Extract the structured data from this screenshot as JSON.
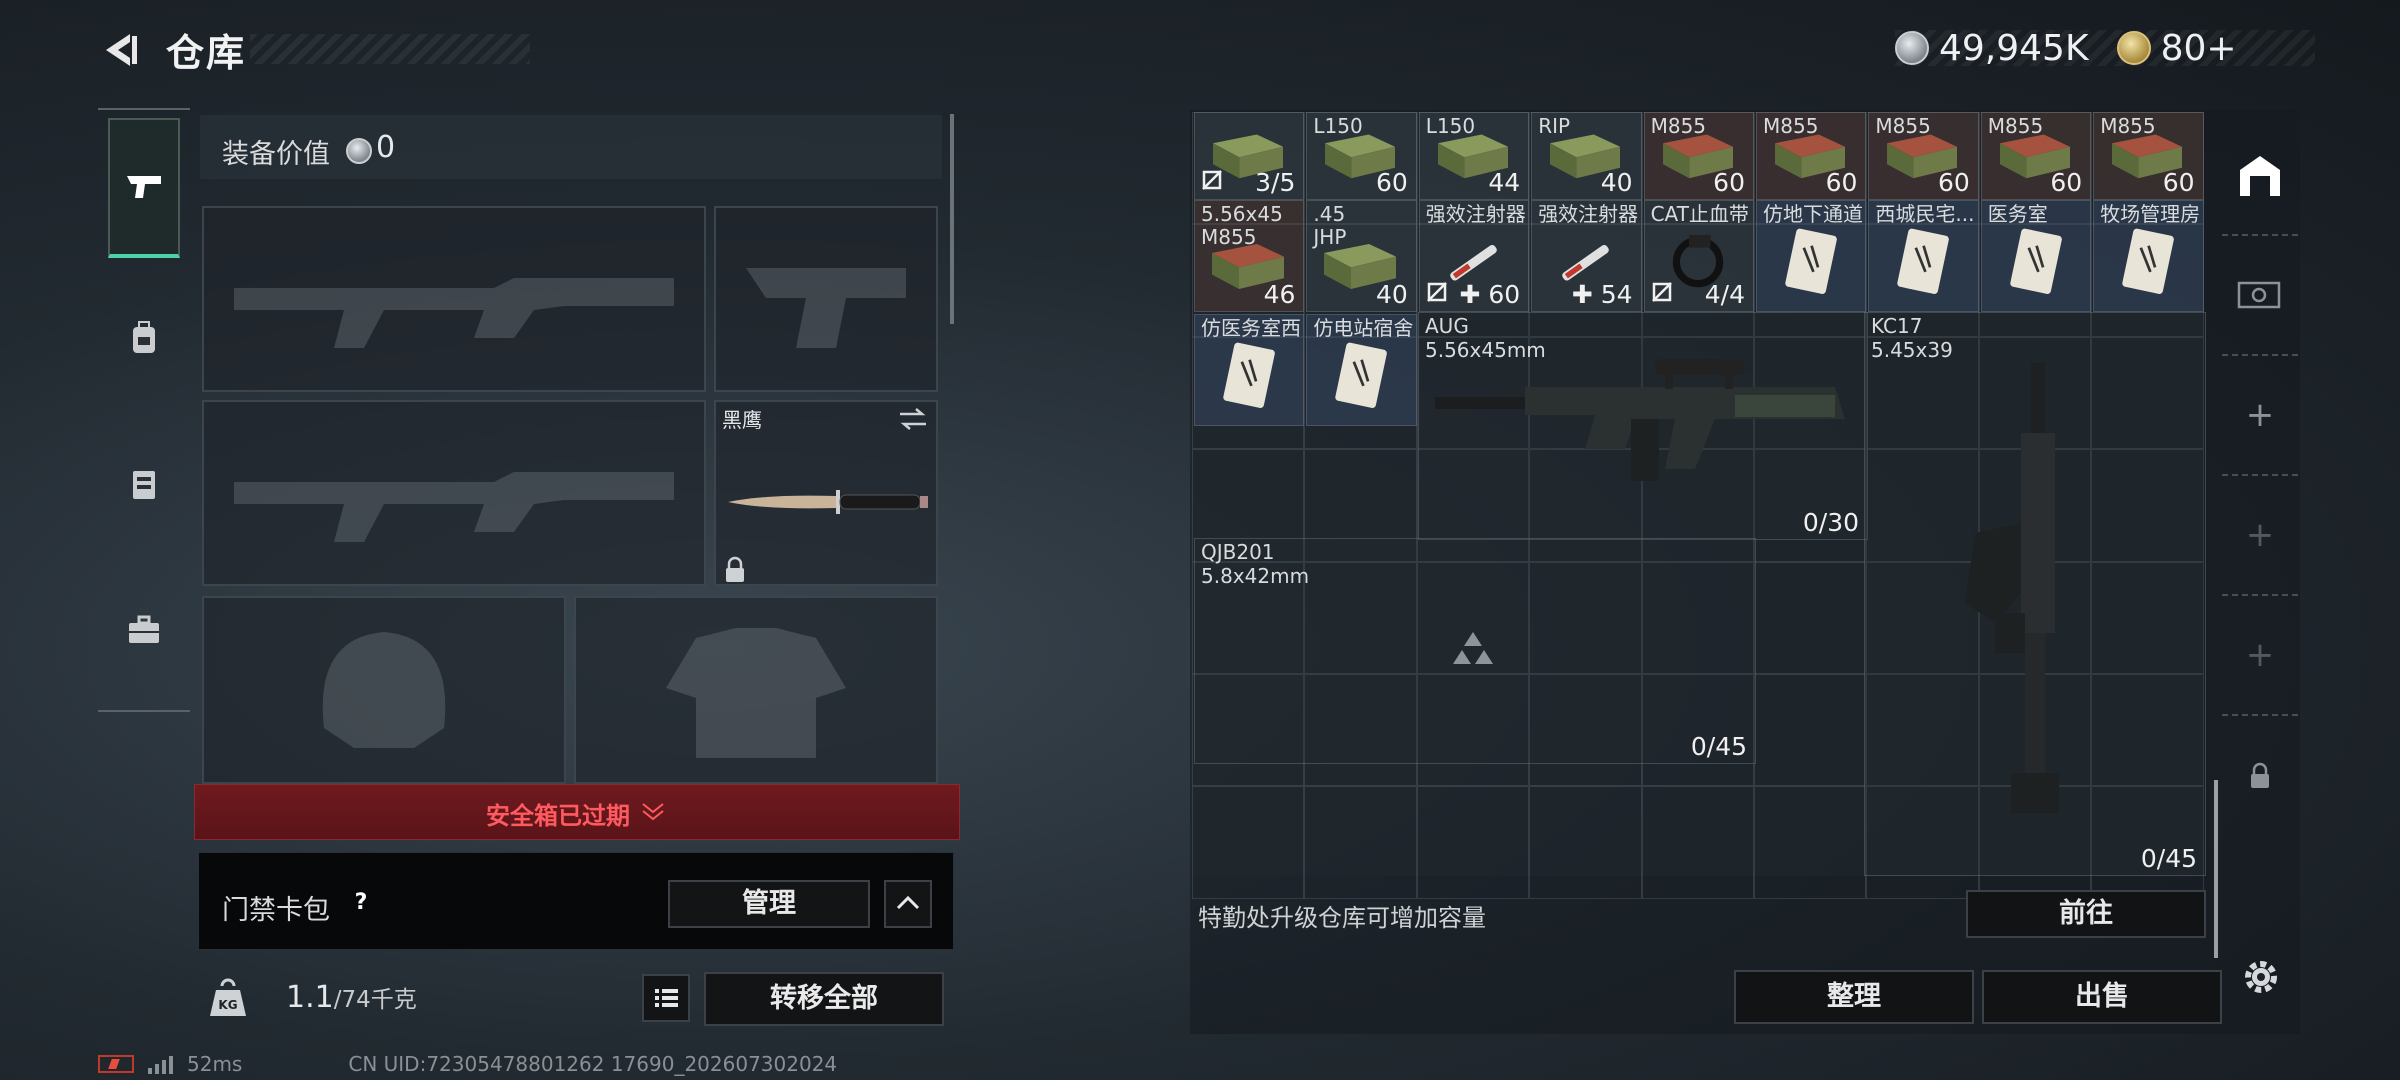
{
  "header": {
    "title": "仓库"
  },
  "currency": {
    "silver_amount": "49,945K",
    "gold_amount": "80+"
  },
  "equipment": {
    "value_label": "装备价值",
    "value": "0",
    "knife_name": "黑鹰",
    "safe_box_status": "安全箱已过期",
    "card_pack_label": "门禁卡包",
    "help_glyph": "?",
    "manage_label": "管理",
    "weight_current": "1.1",
    "weight_max": "/74千克",
    "transfer_all_label": "转移全部"
  },
  "status_bar": {
    "ping": "52ms",
    "uid": "CN UID:72305478801262 17690_202607302024"
  },
  "warehouse": {
    "items_row1": [
      {
        "name": "",
        "count": "3/5",
        "unbound": true
      },
      {
        "name": "L150",
        "count": "60"
      },
      {
        "name": "L150",
        "count": "44"
      },
      {
        "name": "RIP",
        "count": "40"
      },
      {
        "name": "M855",
        "count": "60"
      },
      {
        "name": "M855",
        "count": "60"
      },
      {
        "name": "M855",
        "count": "60"
      },
      {
        "name": "M855",
        "count": "60"
      },
      {
        "name": "M855",
        "count": "60"
      }
    ],
    "items_row2": [
      {
        "name": "5.56x45\nM855",
        "count": "46"
      },
      {
        "name": ".45\nJHP",
        "count": "40"
      },
      {
        "name": "强效注射器",
        "count": "✚ 60",
        "unbound": true
      },
      {
        "name": "强效注射器",
        "count": "✚ 54"
      },
      {
        "name": "CAT止血带",
        "count": "4/4",
        "unbound": true
      },
      {
        "name": "仿地下通道",
        "count": ""
      },
      {
        "name": "西城民宅...",
        "count": ""
      },
      {
        "name": "医务室",
        "count": ""
      },
      {
        "name": "牧场管理房",
        "count": ""
      }
    ],
    "items_row3": [
      {
        "name": "仿医务室西",
        "count": ""
      },
      {
        "name": "仿电站宿舍",
        "count": ""
      }
    ],
    "aug": {
      "name": "AUG",
      "caliber": "5.56x45mm",
      "ammo": "0/30"
    },
    "kc17": {
      "name": "KC17",
      "caliber": "5.45x39",
      "ammo": "0/45"
    },
    "qjb": {
      "name": "QJB201",
      "caliber": "5.8x42mm",
      "ammo": "0/45"
    },
    "upgrade_note": "特勤处升级仓库可增加容量",
    "goto_label": "前往",
    "sort_label": "整理",
    "sell_label": "出售"
  },
  "colors": {
    "accent": "#4fd1a8",
    "danger": "#ff5a5f",
    "danger_bg": "#6f1a1f"
  }
}
